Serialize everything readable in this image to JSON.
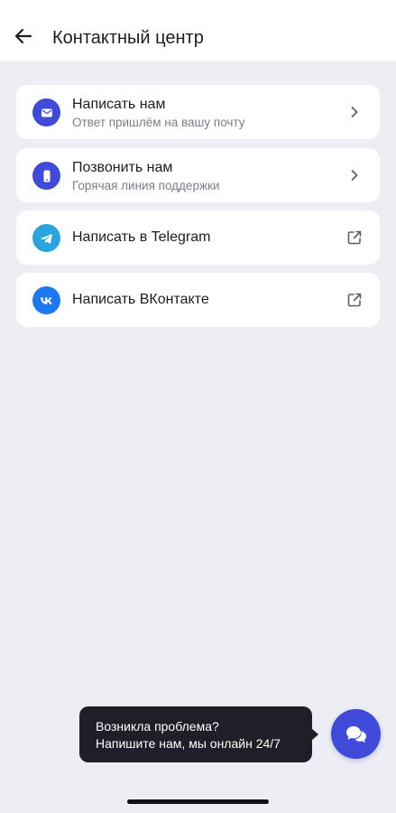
{
  "header": {
    "title": "Контактный центр",
    "back_icon": "arrow-left-icon"
  },
  "contacts": [
    {
      "title": "Написать нам",
      "subtitle": "Ответ пришлём на вашу почту",
      "icon": "mail-icon",
      "icon_color": "#3f4bd8",
      "trail_icon": "chevron-right-icon"
    },
    {
      "title": "Позвонить нам",
      "subtitle": "Горячая линия поддержки",
      "icon": "phone-icon",
      "icon_color": "#3f4bd8",
      "trail_icon": "chevron-right-icon"
    },
    {
      "title": "Написать в Telegram",
      "subtitle": "",
      "icon": "telegram-icon",
      "icon_color": "#2ba3de",
      "trail_icon": "external-link-icon"
    },
    {
      "title": "Написать ВКонтакте",
      "subtitle": "",
      "icon": "vk-icon",
      "icon_color": "#1c78f0",
      "trail_icon": "external-link-icon"
    }
  ],
  "chat_tooltip": {
    "line1": "Возникла проблема?",
    "line2": "Напишите нам, мы онлайн 24/7"
  },
  "chat_button": {
    "icon": "chat-bubbles-icon",
    "color": "#3f4bd8"
  }
}
